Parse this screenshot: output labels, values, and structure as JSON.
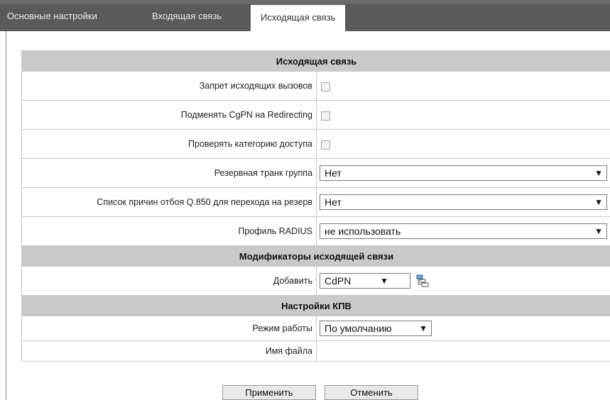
{
  "tabs": [
    {
      "label": "Основные настройки",
      "active": false
    },
    {
      "label": "Входящая связь",
      "active": false
    },
    {
      "label": "Исходящая связь",
      "active": true
    }
  ],
  "section_outgoing": {
    "title": "Исходящая связь",
    "block_outgoing_label": "Запрет исходящих вызовов",
    "block_outgoing_checked": false,
    "replace_cgpn_label": "Подменять CgPN на Redirecting",
    "replace_cgpn_checked": false,
    "check_category_label": "Проверять категорию доступа",
    "check_category_checked": false,
    "backup_trunk_label": "Резервная транк группа",
    "backup_trunk_value": "Нет",
    "q850_label": "Список причин отбоя Q.850 для перехода на резерв",
    "q850_value": "Нет",
    "radius_label": "Профиль RADIUS",
    "radius_value": "не использовать"
  },
  "section_modifiers": {
    "title": "Модификаторы исходящей связи",
    "add_label": "Добавить",
    "add_value": "CdPN"
  },
  "section_kpv": {
    "title": "Настройки КПВ",
    "mode_label": "Режим работы",
    "mode_value": "По умолчанию",
    "filename_label": "Имя файла",
    "filename_value": ""
  },
  "buttons": {
    "apply": "Применить",
    "cancel": "Отменить"
  },
  "icons": {
    "dropdown": "triangle-down-icon",
    "add": "add-modifier-icon"
  }
}
